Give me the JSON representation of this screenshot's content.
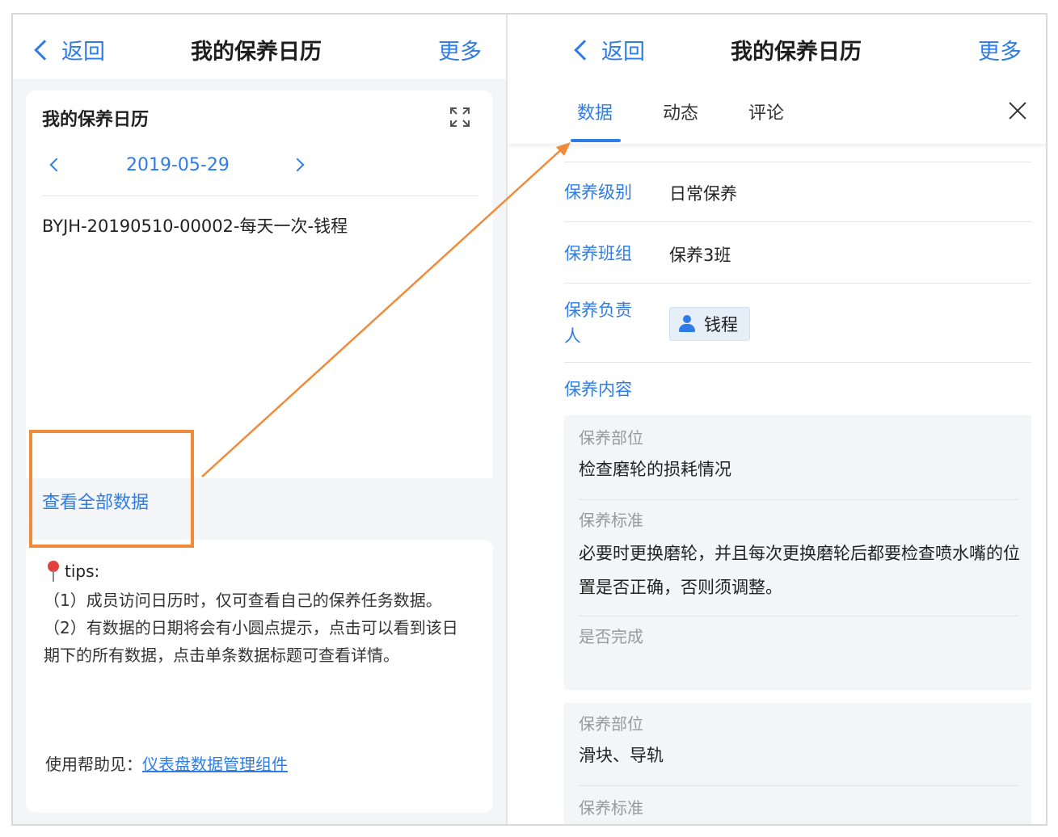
{
  "left_panel": {
    "nav": {
      "back_label": "返回",
      "title": "我的保养日历",
      "more_label": "更多"
    },
    "calendar_card": {
      "title": "我的保养日历",
      "date": "2019-05-29",
      "record": "BYJH-20190510-00002-每天一次-钱程",
      "view_all_label": "查看全部数据"
    },
    "tips": {
      "heading": "tips:",
      "line1": "（1）成员访问日历时，仅可查看自己的保养任务数据。",
      "line2": "（2）有数据的日期将会有小圆点提示，点击可以看到该日期下的所有数据，点击单条数据标题可查看详情。",
      "help_prefix": "使用帮助见：",
      "help_link": "仪表盘数据管理组件"
    }
  },
  "right_panel": {
    "nav": {
      "back_label": "返回",
      "title": "我的保养日历",
      "more_label": "更多"
    },
    "tabs": [
      {
        "label": "数据",
        "active": true
      },
      {
        "label": "动态",
        "active": false
      },
      {
        "label": "评论",
        "active": false
      }
    ],
    "fields": {
      "level_label": "保养级别",
      "level_value": "日常保养",
      "team_label": "保养班组",
      "team_value": "保养3班",
      "owner_label": "保养负责人",
      "owner_value": "钱程",
      "content_label": "保养内容"
    },
    "content_items": [
      {
        "part_label": "保养部位",
        "part_value": "检查磨轮的损耗情况",
        "standard_label": "保养标准",
        "standard_value": "必要时更换磨轮，并且每次更换磨轮后都要检查喷水嘴的位置是否正确，否则须调整。",
        "done_label": "是否完成"
      },
      {
        "part_label": "保养部位",
        "part_value": "滑块、导轨",
        "standard_label": "保养标准"
      }
    ]
  },
  "colors": {
    "accent": "#2f7ce6",
    "highlight": "#ef8b3a"
  }
}
